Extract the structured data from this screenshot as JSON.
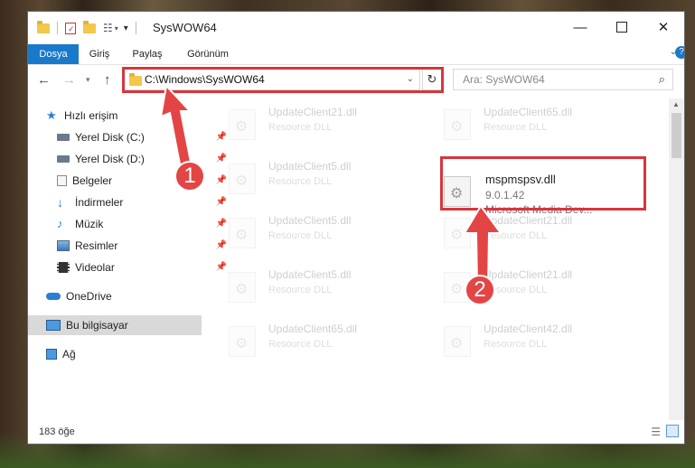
{
  "window": {
    "title": "SysWOW64"
  },
  "ribbon": {
    "tabs": [
      {
        "label": "Dosya",
        "active": true
      },
      {
        "label": "Giriş"
      },
      {
        "label": "Paylaş"
      },
      {
        "label": "Görünüm"
      }
    ]
  },
  "address": {
    "path": "C:\\Windows\\SysWOW64"
  },
  "search": {
    "placeholder": "Ara: SysWOW64"
  },
  "sidebar": {
    "items": [
      {
        "label": "Hızlı erişim",
        "icon": "star-icon"
      },
      {
        "label": "Yerel Disk (C:)",
        "icon": "drive-icon",
        "pinned": true
      },
      {
        "label": "Yerel Disk (D:)",
        "icon": "drive-icon",
        "pinned": true
      },
      {
        "label": "Belgeler",
        "icon": "documents-icon",
        "pinned": true
      },
      {
        "label": "İndirmeler",
        "icon": "download-icon",
        "pinned": true
      },
      {
        "label": "Müzik",
        "icon": "music-icon",
        "pinned": true
      },
      {
        "label": "Resimler",
        "icon": "pictures-icon",
        "pinned": true
      },
      {
        "label": "Videolar",
        "icon": "videos-icon",
        "pinned": true
      },
      {
        "label": "OneDrive",
        "icon": "cloud-icon"
      },
      {
        "label": "Bu bilgisayar",
        "icon": "computer-icon",
        "selected": true
      },
      {
        "label": "Ağ",
        "icon": "network-icon"
      }
    ]
  },
  "files": {
    "left": [
      {
        "name": "UpdateClient21.dll",
        "type": "Resource DLL"
      },
      {
        "name": "UpdateClient5.dll",
        "type": "Resource DLL"
      },
      {
        "name": "UpdateClient5.dll",
        "type": "Resource DLL"
      },
      {
        "name": "UpdateClient5.dll",
        "type": "Resource DLL"
      },
      {
        "name": "UpdateClient65.dll",
        "type": "Resource DLL"
      }
    ],
    "right": [
      {
        "name": "UpdateClient65.dll",
        "type": "Resource DLL"
      },
      {
        "name": "mspmspsv.dll",
        "version": "9.0.1.42",
        "type": "Microsoft Media Dev...",
        "highlight": true
      },
      {
        "name": "UpdateClient21.dll",
        "type": "Resource DLL"
      },
      {
        "name": "UpdateClient21.dll",
        "type": "Resource DLL"
      },
      {
        "name": "UpdateClient42.dll",
        "type": "Resource DLL"
      }
    ]
  },
  "status": {
    "count": "183 öğe"
  },
  "annotations": {
    "badge1": "1",
    "badge2": "2",
    "color": "#e34545"
  }
}
